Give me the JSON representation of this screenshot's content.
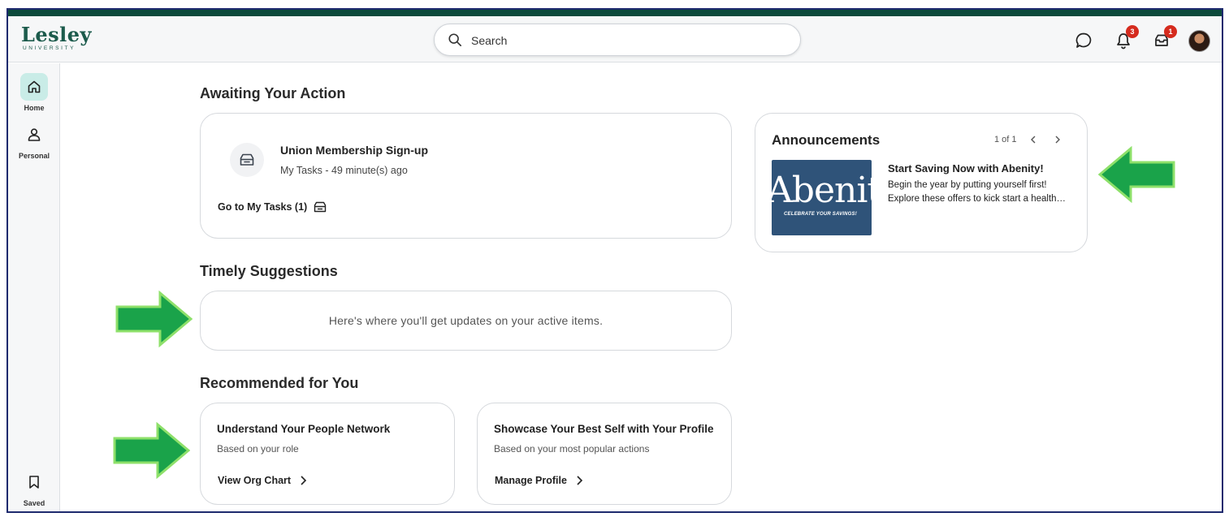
{
  "brand": {
    "name": "Lesley",
    "subtitle": "UNIVERSITY",
    "colors": {
      "top_bar": "#0c4a3c",
      "accent": "#1c5b4c",
      "badge": "#d52b1e",
      "nav_active": "#c9ece7",
      "annotation_arrow": "#1aa34a"
    }
  },
  "header": {
    "search_label": "Search",
    "icons": [
      "search-icon",
      "chat-icon",
      "bell-icon",
      "inbox-icon",
      "avatar"
    ],
    "notifications_badge": "3",
    "inbox_badge": "1"
  },
  "sidebar": {
    "items": [
      {
        "label": "Home",
        "icon": "home-icon",
        "active": true
      },
      {
        "label": "Personal",
        "icon": "person-icon",
        "active": false
      },
      {
        "label": "Saved",
        "icon": "bookmark-icon",
        "active": false
      }
    ]
  },
  "awaiting": {
    "title": "Awaiting Your Action",
    "task_title": "Union Membership Sign-up",
    "task_sub": "My Tasks - 49 minute(s) ago",
    "link_label": "Go to My Tasks (1)"
  },
  "announcements": {
    "title": "Announcements",
    "pager": "1 of 1",
    "image_word": "Abenity",
    "image_tagline": "CELEBRATE YOUR SAVINGS!",
    "headline": "Start Saving Now with Abenity!",
    "body_line1": "Begin the year by putting yourself first!",
    "body_line2": "Explore these offers to kick start a healthy new year."
  },
  "suggestions": {
    "title": "Timely Suggestions",
    "empty_text": "Here's where you'll get updates on your active items."
  },
  "recommended": {
    "title": "Recommended for You",
    "cards": [
      {
        "title": "Understand Your People Network",
        "sub": "Based on your role",
        "link": "View Org Chart"
      },
      {
        "title": "Showcase Your Best Self with Your Profile",
        "sub": "Based on your most popular actions",
        "link": "Manage Profile"
      }
    ]
  }
}
